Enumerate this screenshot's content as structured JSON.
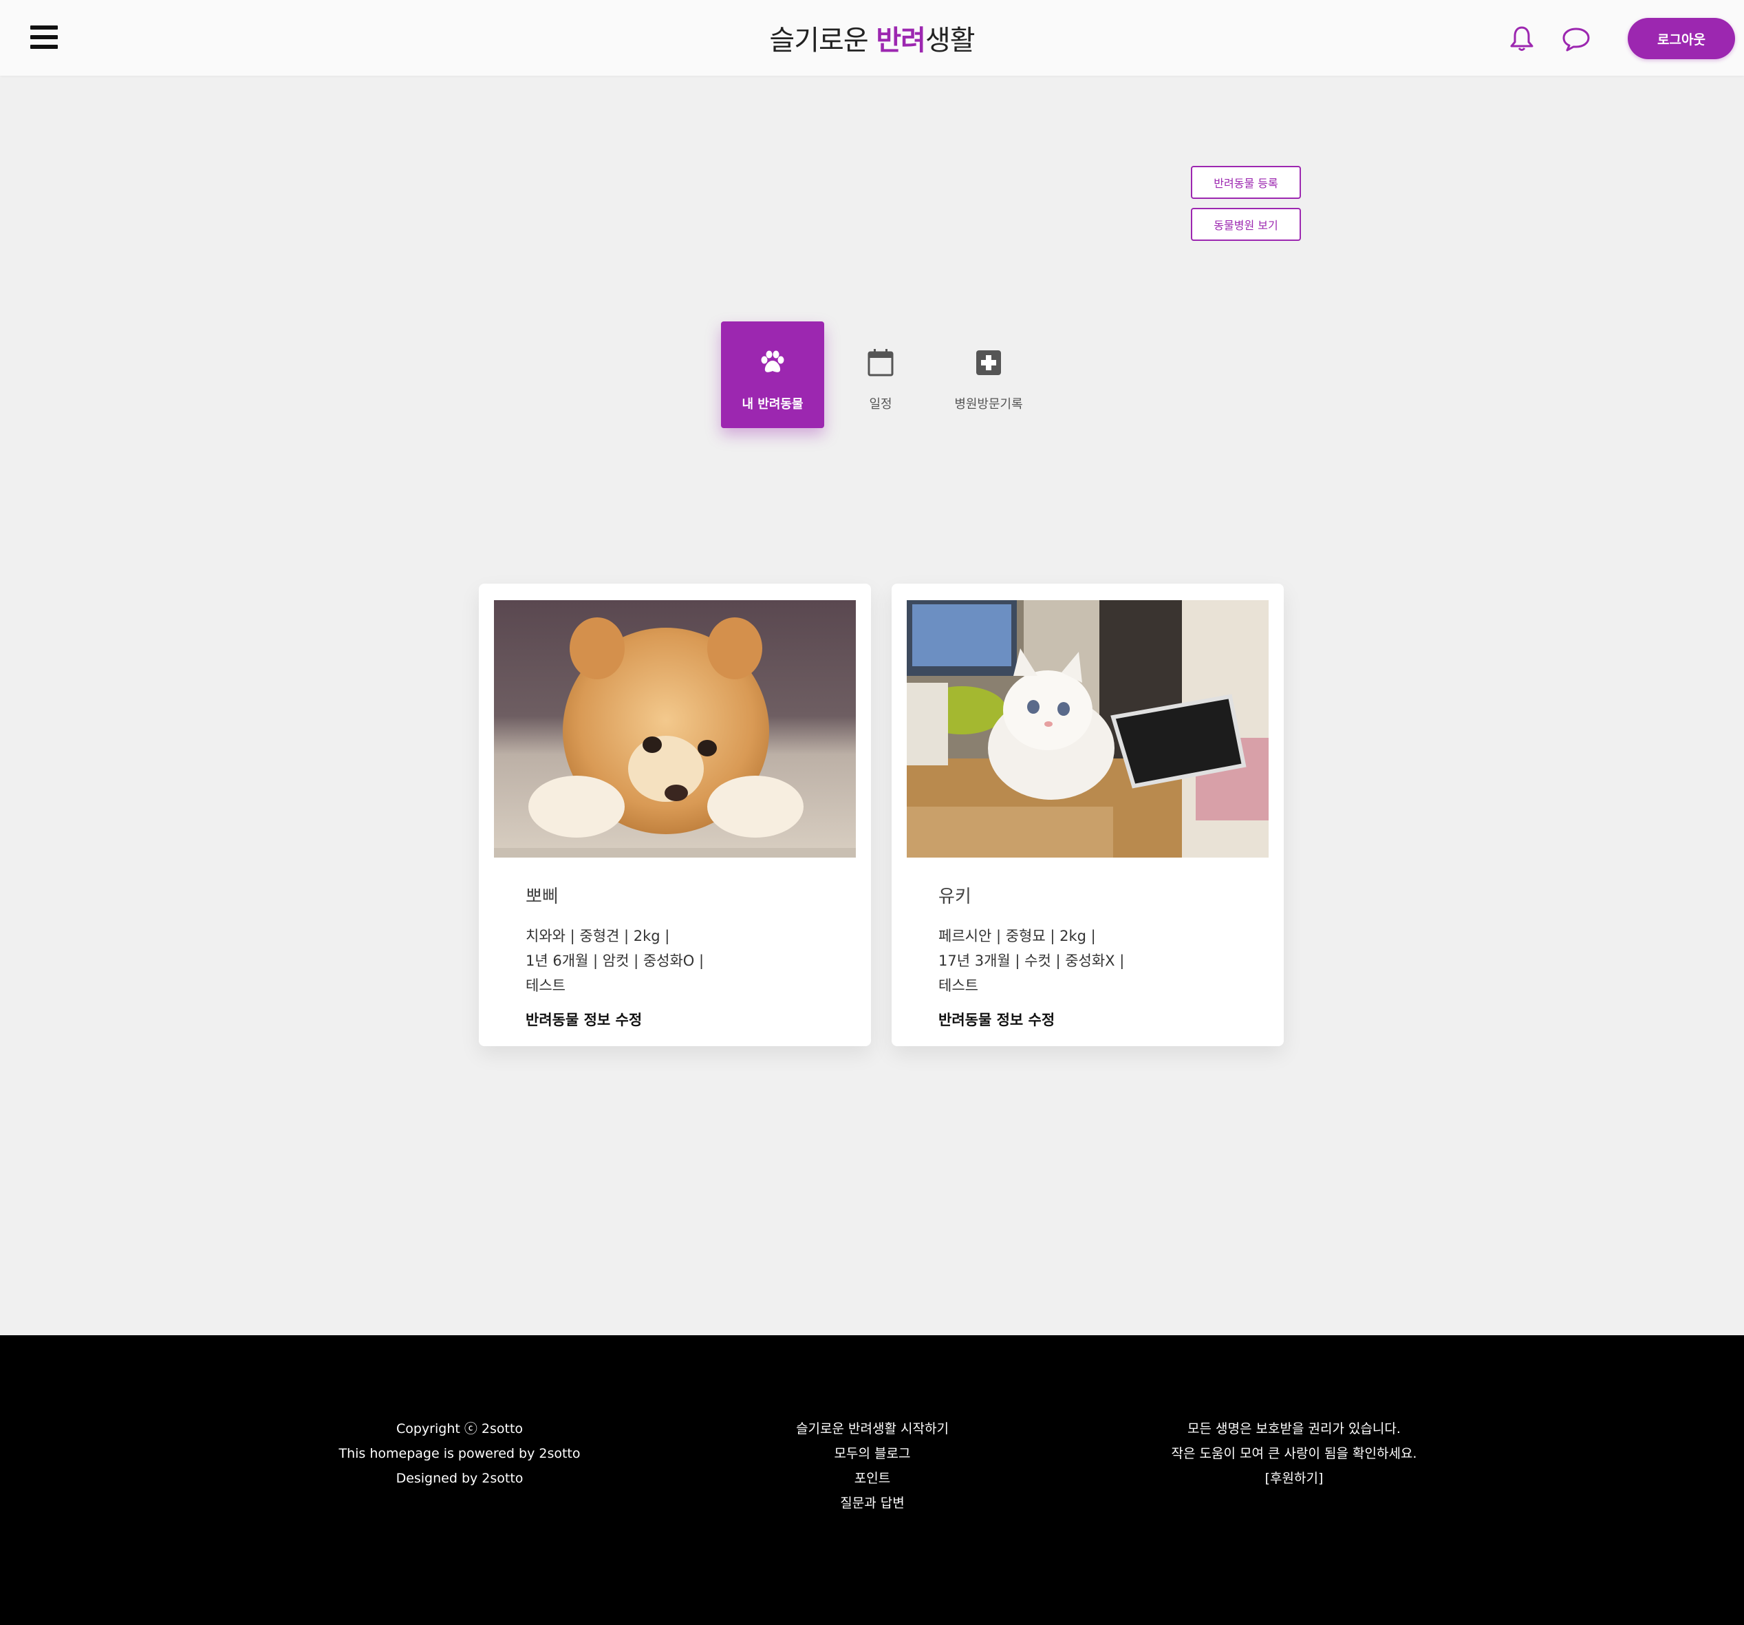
{
  "header": {
    "title_prefix": "슬기로운 ",
    "title_accent": "반려",
    "title_suffix": "생활",
    "logout_label": "로그아웃"
  },
  "actions": {
    "register_pet": "반려동물 등록",
    "view_hospitals": "동물병원 보기"
  },
  "tabs": [
    {
      "label": "내 반려동물",
      "icon": "paw-icon",
      "active": true
    },
    {
      "label": "일정",
      "icon": "calendar-icon",
      "active": false
    },
    {
      "label": "병원방문기록",
      "icon": "medical-cross-icon",
      "active": false
    }
  ],
  "pets": [
    {
      "name": "뽀삐",
      "line1": "치와와 | 중형견 | 2kg |",
      "line2": "1년 6개월 | 암컷 | 중성화O |",
      "line3": "테스트",
      "edit_label": "반려동물 정보 수정",
      "photo": "pomeranian-photo"
    },
    {
      "name": "유키",
      "line1": "페르시안 | 중형묘 | 2kg |",
      "line2": "17년 3개월 | 수컷 | 중성화X |",
      "line3": "테스트",
      "edit_label": "반려동물 정보 수정",
      "photo": "white-persian-cat-photo"
    }
  ],
  "footer": {
    "col1": [
      "Copyright ⓒ 2sotto",
      "This homepage is powered by 2sotto",
      "Designed by 2sotto"
    ],
    "col2": [
      "슬기로운 반려생활 시작하기",
      "모두의 블로그",
      "포인트",
      "질문과 답변"
    ],
    "col3": [
      "모든 생명은 보호받을 권리가 있습니다.",
      "작은 도움이 모여 큰 사랑이 됨을 확인하세요.",
      "[후원하기]"
    ]
  },
  "colors": {
    "accent": "#9c27b0",
    "background": "#f0f0f0",
    "footer": "#000000"
  }
}
